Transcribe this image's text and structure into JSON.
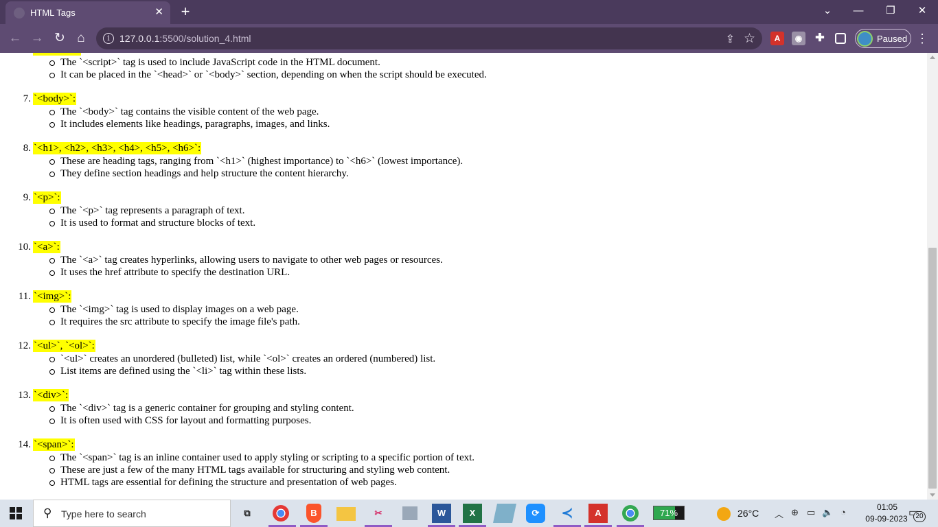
{
  "browser": {
    "tab_title": "HTML Tags",
    "tab_close": "✕",
    "new_tab": "+",
    "url_host": "127.0.0.1",
    "url_path": ":5500/solution_4.html",
    "profile_status": "Paused",
    "window_controls": {
      "dropdown": "⌄",
      "minimize": "—",
      "restore": "❐",
      "close": "✕"
    }
  },
  "page": {
    "items": [
      {
        "num": "",
        "title": "",
        "bullets": [
          "The `<script>` tag is used to include JavaScript code in the HTML document.",
          "It can be placed in the `<head>` or `<body>` section, depending on when the script should be executed."
        ]
      },
      {
        "num": "7.",
        "title": "`<body>`:",
        "bullets": [
          "The `<body>` tag contains the visible content of the web page.",
          "It includes elements like headings, paragraphs, images, and links."
        ]
      },
      {
        "num": "8.",
        "title": "`<h1>, <h2>, <h3>, <h4>, <h5>, <h6>`:",
        "bullets": [
          "These are heading tags, ranging from `<h1>` (highest importance) to `<h6>` (lowest importance).",
          "They define section headings and help structure the content hierarchy."
        ]
      },
      {
        "num": "9.",
        "title": "`<p>`:",
        "bullets": [
          "The `<p>` tag represents a paragraph of text.",
          "It is used to format and structure blocks of text."
        ]
      },
      {
        "num": "10.",
        "title": "`<a>`:",
        "bullets": [
          "The `<a>` tag creates hyperlinks, allowing users to navigate to other web pages or resources.",
          "It uses the href attribute to specify the destination URL."
        ]
      },
      {
        "num": "11.",
        "title": "`<img>`:",
        "bullets": [
          "The `<img>` tag is used to display images on a web page.",
          "It requires the src attribute to specify the image file's path."
        ]
      },
      {
        "num": "12.",
        "title": "`<ul>`, `<ol>`:",
        "bullets": [
          "`<ul>` creates an unordered (bulleted) list, while `<ol>` creates an ordered (numbered) list.",
          "List items are defined using the `<li>` tag within these lists."
        ]
      },
      {
        "num": "13.",
        "title": "`<div>`:",
        "bullets": [
          "The `<div>` tag is a generic container for grouping and styling content.",
          "It is often used with CSS for layout and formatting purposes."
        ]
      },
      {
        "num": "14.",
        "title": "`<span>`:",
        "bullets": [
          "The `<span>` tag is an inline container used to apply styling or scripting to a specific portion of text.",
          "These are just a few of the many HTML tags available for structuring and styling web content.",
          "HTML tags are essential for defining the structure and presentation of web pages."
        ]
      }
    ],
    "highlight_color": "#ffff00"
  },
  "taskbar": {
    "search_placeholder": "Type here to search",
    "battery_percent": "71%",
    "battery_level": 0.71,
    "temperature": "26°C",
    "time": "01:05",
    "date": "09-09-2023",
    "notification_count": "20"
  }
}
